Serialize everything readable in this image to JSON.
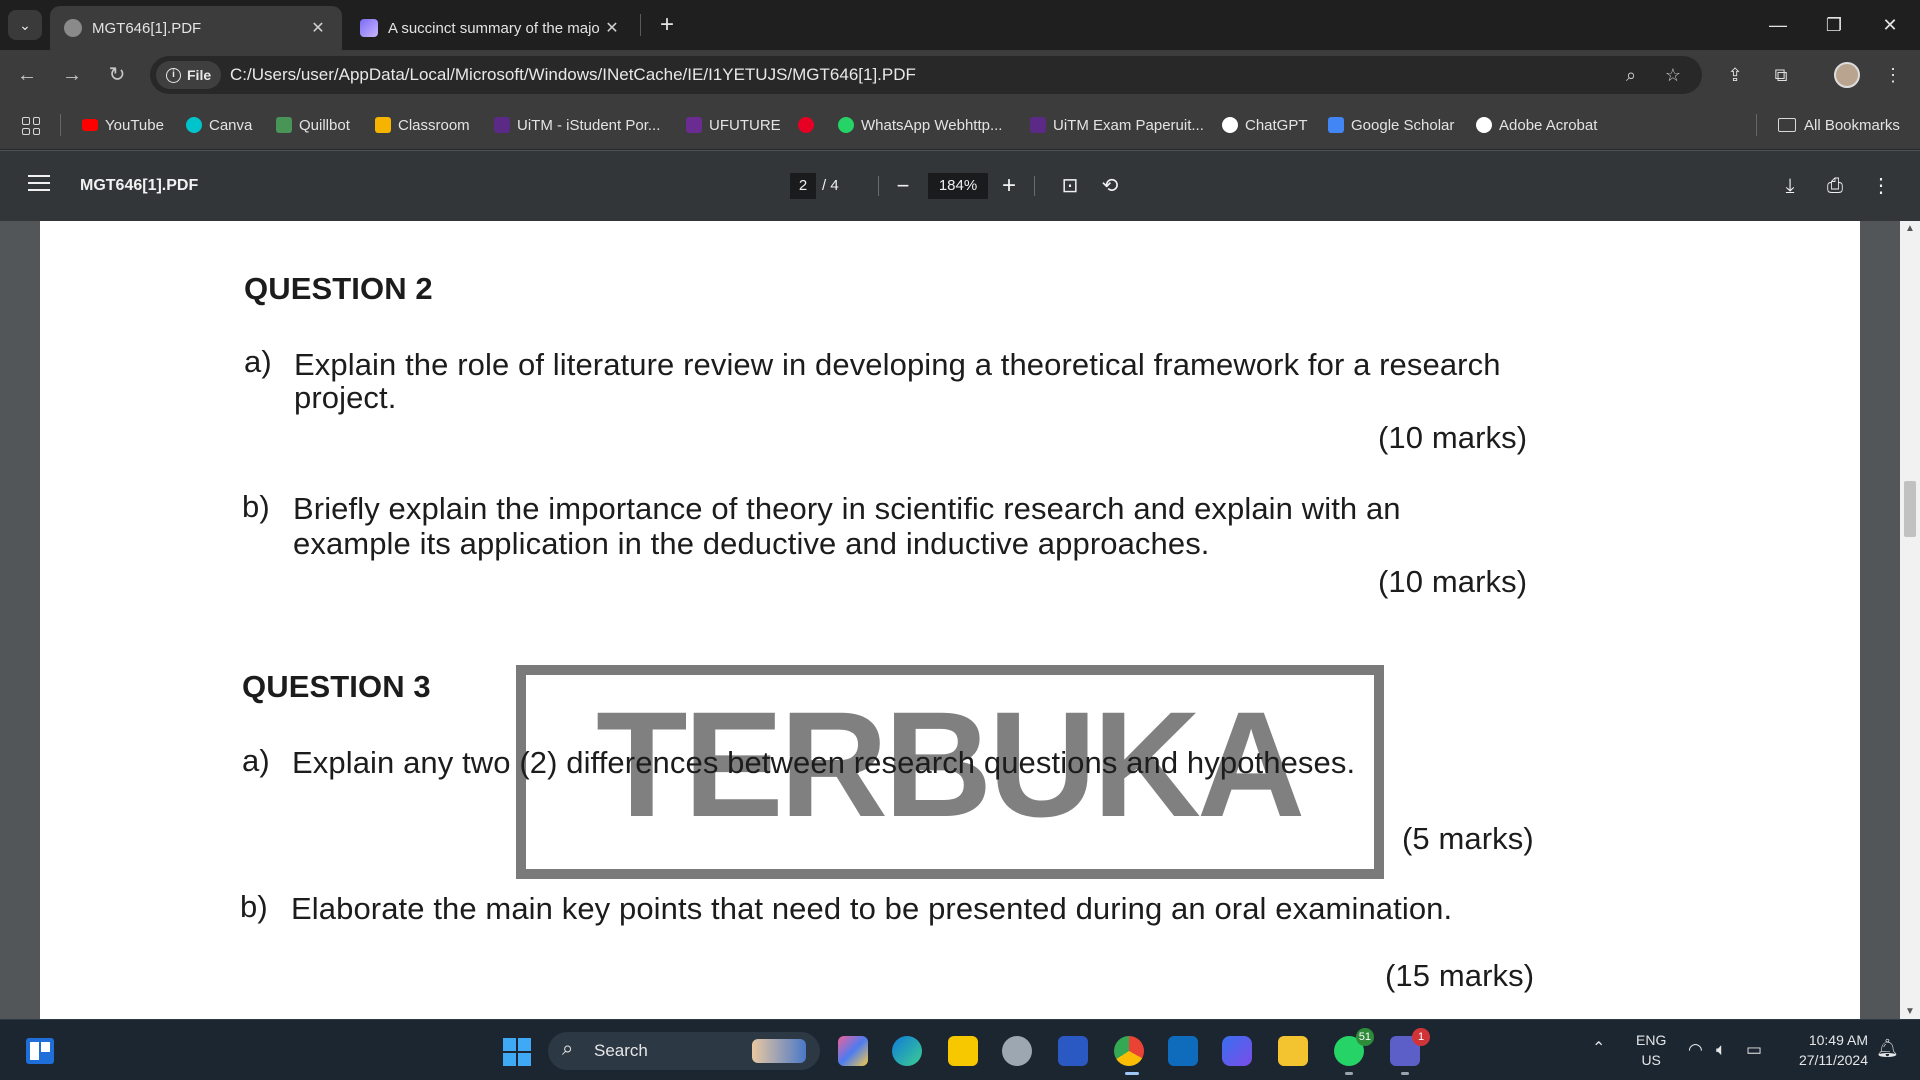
{
  "browser": {
    "tabs": [
      {
        "title": "MGT646[1].PDF",
        "active": true
      },
      {
        "title": "A succinct summary of the majo",
        "active": false
      }
    ],
    "address": {
      "site_chip": "File",
      "url": "C:/Users/user/AppData/Local/Microsoft/Windows/INetCache/IE/I1YETUJS/MGT646[1].PDF"
    },
    "bookmarks": [
      {
        "label": "YouTube",
        "color": "#ff0000"
      },
      {
        "label": "Canva",
        "color": "#00c4cc"
      },
      {
        "label": "Quillbot",
        "color": "#499557"
      },
      {
        "label": "Classroom",
        "color": "#f6b400"
      },
      {
        "label": "UiTM - iStudent Por...",
        "color": "#5b2a86"
      },
      {
        "label": "UFUTURE",
        "color": "#6a2c91"
      },
      {
        "label": "WhatsApp Webhttp...",
        "color": "#25d366"
      },
      {
        "label": "UiTM Exam Paperuit...",
        "color": "#5b2a86"
      },
      {
        "label": "ChatGPT",
        "color": "#ffffff"
      },
      {
        "label": "Google Scholar",
        "color": "#4285f4"
      },
      {
        "label": "Adobe Acrobat",
        "color": "#ffffff"
      }
    ],
    "all_bookmarks": "All Bookmarks"
  },
  "pdf_toolbar": {
    "title": "MGT646[1].PDF",
    "page_current": "2",
    "page_of": "/  4",
    "zoom": "184%"
  },
  "document": {
    "q2_heading": "QUESTION 2",
    "q2a_label": "a)",
    "q2a_line1": "Explain the role of literature review in developing a theoretical framework for a research",
    "q2a_line2": "project.",
    "q2a_marks": "(10 marks)",
    "q2b_label": "b)",
    "q2b_line1": "Briefly explain the importance of theory in scientific research and explain with an",
    "q2b_line2": "example its application in the deductive and inductive approaches.",
    "q2b_marks": "(10 marks)",
    "q3_heading": "QUESTION 3",
    "q3a_label": "a)",
    "q3a_line1": "Explain any two (2) differences between research questions and hypotheses.",
    "q3a_marks": "(5 marks)",
    "q3b_label": "b)",
    "q3b_line1": "Elaborate the main key points that need to be presented during an oral examination.",
    "q3b_marks": "(15 marks)",
    "stamp": "TERBUKA"
  },
  "taskbar": {
    "search_label": "Search",
    "whatsapp_badge": "51",
    "teams_badge": "1",
    "lang_line1": "ENG",
    "lang_line2": "US",
    "time": "10:49 AM",
    "date": "27/11/2024"
  }
}
